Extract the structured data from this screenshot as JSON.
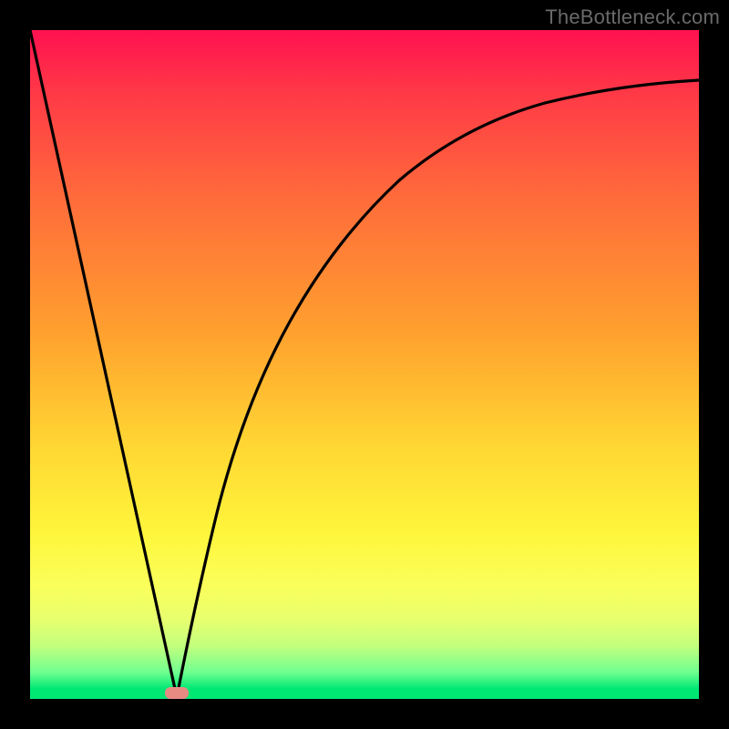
{
  "watermark": "TheBottleneck.com",
  "chart_data": {
    "type": "line",
    "title": "",
    "xlabel": "",
    "ylabel": "",
    "xlim": [
      0,
      100
    ],
    "ylim": [
      0,
      100
    ],
    "grid": false,
    "legend": false,
    "series": [
      {
        "name": "left-descending-line",
        "x": [
          0,
          22
        ],
        "values": [
          100,
          0
        ]
      },
      {
        "name": "right-rising-curve",
        "x": [
          22,
          26,
          30,
          35,
          40,
          45,
          50,
          55,
          60,
          65,
          70,
          75,
          80,
          85,
          90,
          95,
          100
        ],
        "values": [
          0,
          19,
          35,
          50,
          60,
          67,
          73,
          77,
          80.5,
          83,
          85,
          86.5,
          88,
          89,
          90,
          90.8,
          91.5
        ]
      }
    ],
    "annotations": [
      {
        "name": "vertex-marker",
        "x": 22,
        "y": 0,
        "color": "#e78b82"
      }
    ],
    "background_gradient": {
      "top": "#ff1150",
      "upper_mid": "#ffa02e",
      "lower_mid": "#fff53b",
      "bottom": "#00e874"
    }
  }
}
